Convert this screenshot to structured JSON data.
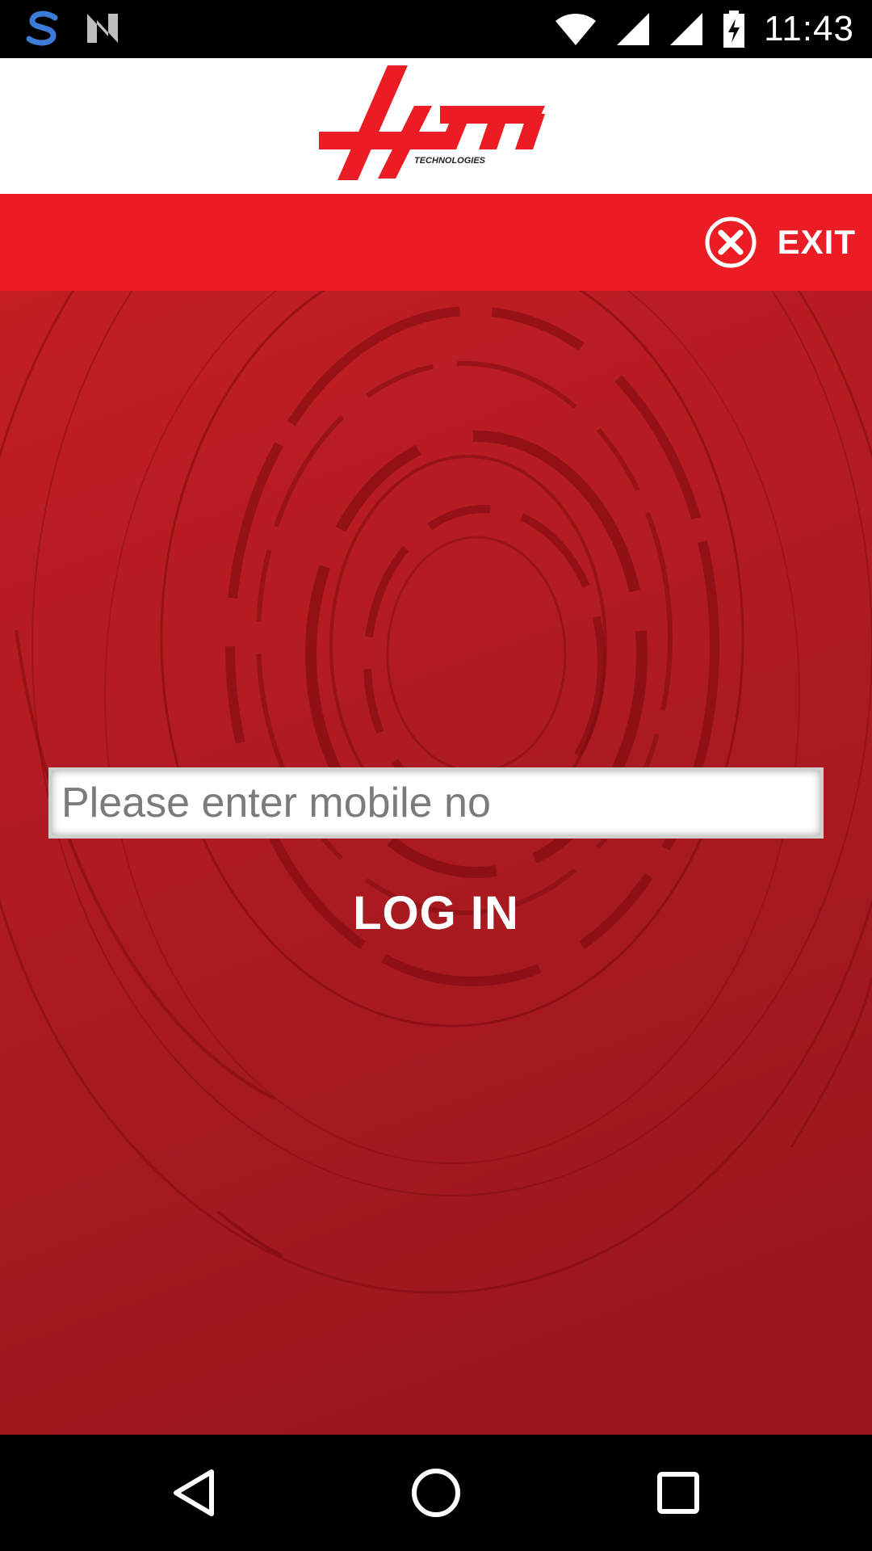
{
  "status_bar": {
    "time": "11:43",
    "left_icons": [
      "s-app-icon",
      "n-app-icon"
    ],
    "right_icons": [
      "wifi-icon",
      "signal-icon",
      "signal-icon-2",
      "battery-charging-icon"
    ]
  },
  "header": {
    "logo_text": "lym",
    "logo_subtext": "TECHNOLOGIES"
  },
  "toolbar": {
    "exit_label": "EXIT",
    "exit_icon": "close-circle-icon"
  },
  "login": {
    "mobile_placeholder": "Please enter mobile no",
    "login_label": "LOG IN"
  },
  "colors": {
    "brand_red": "#ec1c24",
    "background_red": "#b01c22"
  },
  "nav_bar": {
    "icons": [
      "back-icon",
      "home-icon",
      "recents-icon"
    ]
  }
}
